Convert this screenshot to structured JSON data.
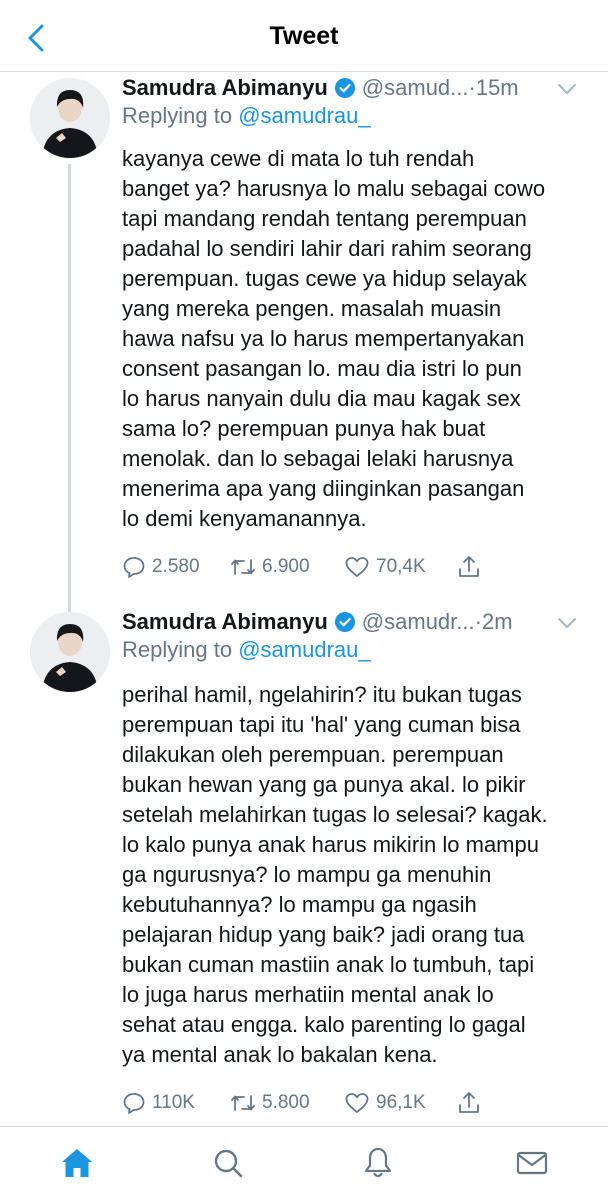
{
  "header": {
    "title": "Tweet"
  },
  "tweets": [
    {
      "display_name": "Samudra Abimanyu",
      "handle": "@samud...",
      "dot": "·",
      "time": "15m",
      "replying_prefix": "Replying to",
      "replying_handle": "@samudrau_",
      "lines": [
        "kayanya cewe di mata lo tuh rendah",
        "banget ya? harusnya lo malu sebagai cowo",
        "tapi mandang rendah tentang perempuan",
        "padahal lo sendiri lahir dari rahim seorang",
        "perempuan. tugas cewe ya hidup selayak",
        "yang mereka pengen. masalah muasin",
        "hawa nafsu ya lo harus mempertanyakan",
        "consent pasangan lo. mau dia istri lo pun",
        "lo harus nanyain dulu dia mau kagak sex",
        "sama lo? perempuan punya hak buat",
        "menolak. dan lo sebagai lelaki harusnya",
        "menerima apa yang diinginkan pasangan",
        "lo demi kenyamanannya."
      ],
      "replies": "2.580",
      "retweets": "6.900",
      "likes": "70,4K"
    },
    {
      "display_name": "Samudra Abimanyu",
      "handle": "@samudr...",
      "dot": "·",
      "time": "2m",
      "replying_prefix": "Replying to",
      "replying_handle": "@samudrau_",
      "lines": [
        "perihal hamil, ngelahirin? itu bukan tugas",
        "perempuan tapi itu 'hal' yang cuman bisa",
        "dilakukan oleh perempuan. perempuan",
        "bukan hewan yang ga punya akal. lo pikir",
        "setelah melahirkan tugas lo selesai? kagak.",
        "lo kalo punya anak harus mikirin lo mampu",
        "ga ngurusnya? lo mampu ga menuhin",
        "kebutuhannya? lo mampu ga ngasih",
        "pelajaran hidup yang baik? jadi orang tua",
        "bukan cuman mastiin anak lo tumbuh, tapi",
        "lo juga harus merhatiin mental anak lo",
        "sehat atau engga. kalo parenting lo gagal",
        "ya mental anak lo bakalan kena."
      ],
      "replies": "110K",
      "retweets": "5.800",
      "likes": "96,1K"
    }
  ],
  "colors": {
    "accent": "#1b95e0",
    "secondary_text": "#657786",
    "primary_text": "#14171a",
    "divider": "#d9dde1"
  },
  "icons": {
    "back": "chevron-left-icon",
    "verified": "verified-badge-icon",
    "caret": "chevron-down-icon",
    "reply": "reply-icon",
    "retweet": "retweet-icon",
    "like": "heart-icon",
    "share": "share-icon",
    "home": "home-icon",
    "search": "search-icon",
    "notifications": "bell-icon",
    "messages": "mail-icon"
  }
}
